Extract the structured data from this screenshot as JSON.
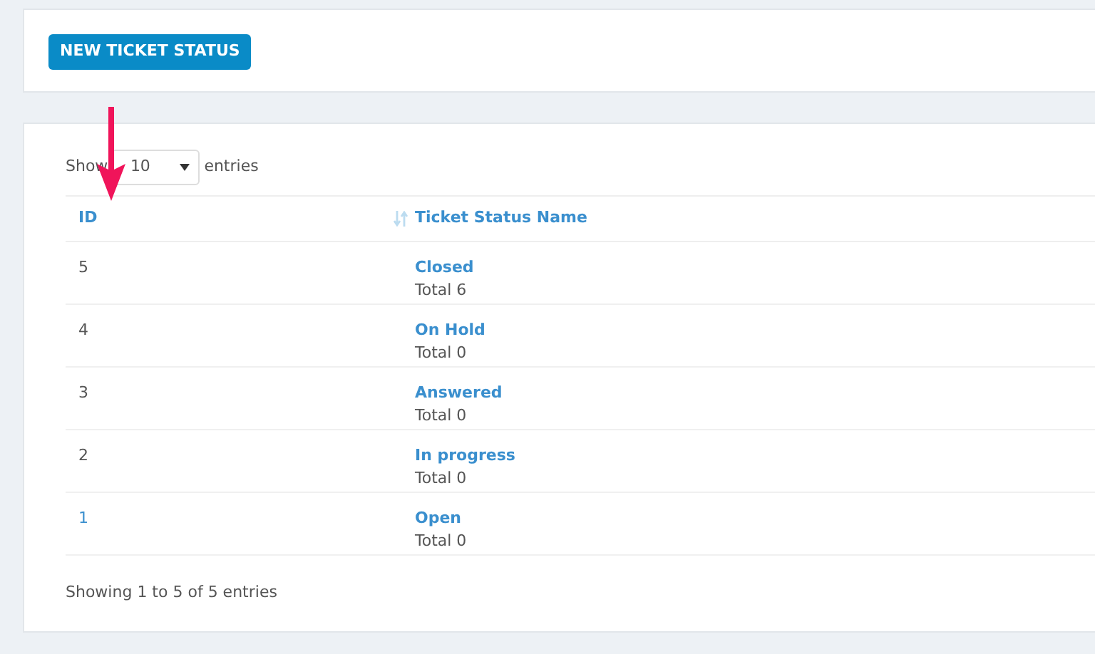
{
  "toolbar": {
    "new_button": "NEW TICKET STATUS"
  },
  "length_menu": {
    "label_before": "Show",
    "value": "10",
    "label_after": "entries"
  },
  "table": {
    "columns": [
      {
        "label": "ID",
        "sortable": true
      },
      {
        "label": "Ticket Status Name",
        "sortable": false
      }
    ],
    "rows": [
      {
        "id": "5",
        "id_linked": false,
        "name": "Closed",
        "total": "Total 6"
      },
      {
        "id": "4",
        "id_linked": false,
        "name": "On Hold",
        "total": "Total 0"
      },
      {
        "id": "3",
        "id_linked": false,
        "name": "Answered",
        "total": "Total 0"
      },
      {
        "id": "2",
        "id_linked": false,
        "name": "In progress",
        "total": "Total 0"
      },
      {
        "id": "1",
        "id_linked": true,
        "name": "Open",
        "total": "Total 0"
      }
    ]
  },
  "info": "Showing 1 to 5 of 5 entries"
}
